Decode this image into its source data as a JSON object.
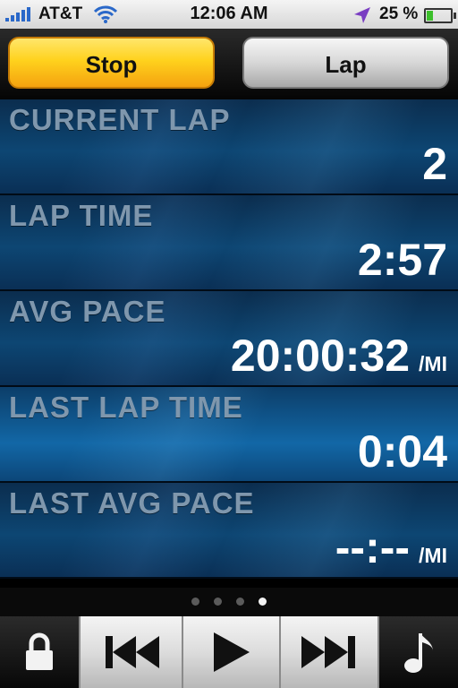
{
  "status_bar": {
    "carrier": "AT&T",
    "time": "12:06 AM",
    "battery_percent": "25 %",
    "battery_level": 0.25,
    "icons": [
      "signal-bars-icon",
      "wifi-icon",
      "location-arrow-icon",
      "battery-icon"
    ]
  },
  "buttons": {
    "stop_label": "Stop",
    "lap_label": "Lap"
  },
  "stats": [
    {
      "label": "CURRENT LAP",
      "value": "2",
      "unit": ""
    },
    {
      "label": "LAP TIME",
      "value": "2:57",
      "unit": ""
    },
    {
      "label": "AVG PACE",
      "value": "20:00:32",
      "unit": "/MI"
    },
    {
      "label": "LAST LAP TIME",
      "value": "0:04",
      "unit": ""
    },
    {
      "label": "LAST AVG PACE",
      "value": "--:--",
      "unit": "/MI"
    }
  ],
  "pager": {
    "total_pages": 4,
    "current_page": 4
  },
  "controls": [
    "lock-icon",
    "skip-back-icon",
    "play-icon",
    "skip-forward-icon",
    "music-note-icon"
  ],
  "colors": {
    "stop_button": "#ffd21d",
    "lap_button": "#d7d7d7",
    "stat_background": "#0d4673",
    "stat_label": "#7f97ad",
    "stat_value": "#ffffff"
  }
}
